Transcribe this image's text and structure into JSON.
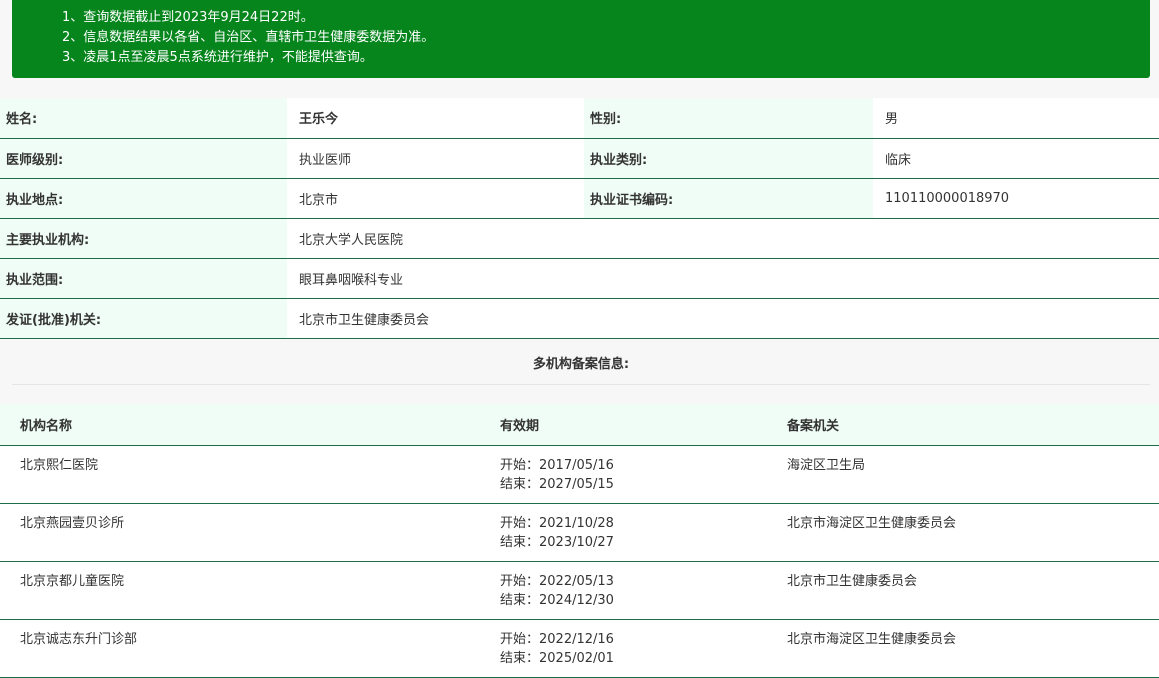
{
  "notice": {
    "lines": [
      "1、查询数据截止到2023年9月24日22时。",
      "2、信息数据结果以各省、自治区、直辖市卫生健康委数据为准。",
      "3、凌晨1点至凌晨5点系统进行维护，不能提供查询。"
    ]
  },
  "doctor": {
    "name_label": "姓名:",
    "name": "王乐今",
    "gender_label": "性别:",
    "gender": "男",
    "level_label": "医师级别:",
    "level": "执业医师",
    "category_label": "执业类别:",
    "category": "临床",
    "location_label": "执业地点:",
    "location": "北京市",
    "cert_label": "执业证书编码:",
    "cert": "110110000018970",
    "institution_label": "主要执业机构:",
    "institution": "北京大学人民医院",
    "scope_label": "执业范围:",
    "scope": "眼耳鼻咽喉科专业",
    "issuer_label": "发证(批准)机关:",
    "issuer": "北京市卫生健康委员会"
  },
  "multi_org": {
    "title": "多机构备案信息:",
    "headers": [
      "机构名称",
      "有效期",
      "备案机关"
    ],
    "rows": [
      {
        "name": "北京熙仁医院",
        "start": "开始：2017/05/16",
        "end": "结束：2027/05/15",
        "authority": "海淀区卫生局"
      },
      {
        "name": "北京燕园壹贝诊所",
        "start": "开始：2021/10/28",
        "end": "结束：2023/10/27",
        "authority": "北京市海淀区卫生健康委员会"
      },
      {
        "name": "北京京都儿童医院",
        "start": "开始：2022/05/13",
        "end": "结束：2024/12/30",
        "authority": "北京市卫生健康委员会"
      },
      {
        "name": "北京诚志东升门诊部",
        "start": "开始：2022/12/16",
        "end": "结束：2025/02/01",
        "authority": "北京市海淀区卫生健康委员会"
      }
    ]
  },
  "colors": {
    "notice_bg": "#05851c",
    "label_bg": "#f0fdf7",
    "border": "#1f6d48"
  }
}
